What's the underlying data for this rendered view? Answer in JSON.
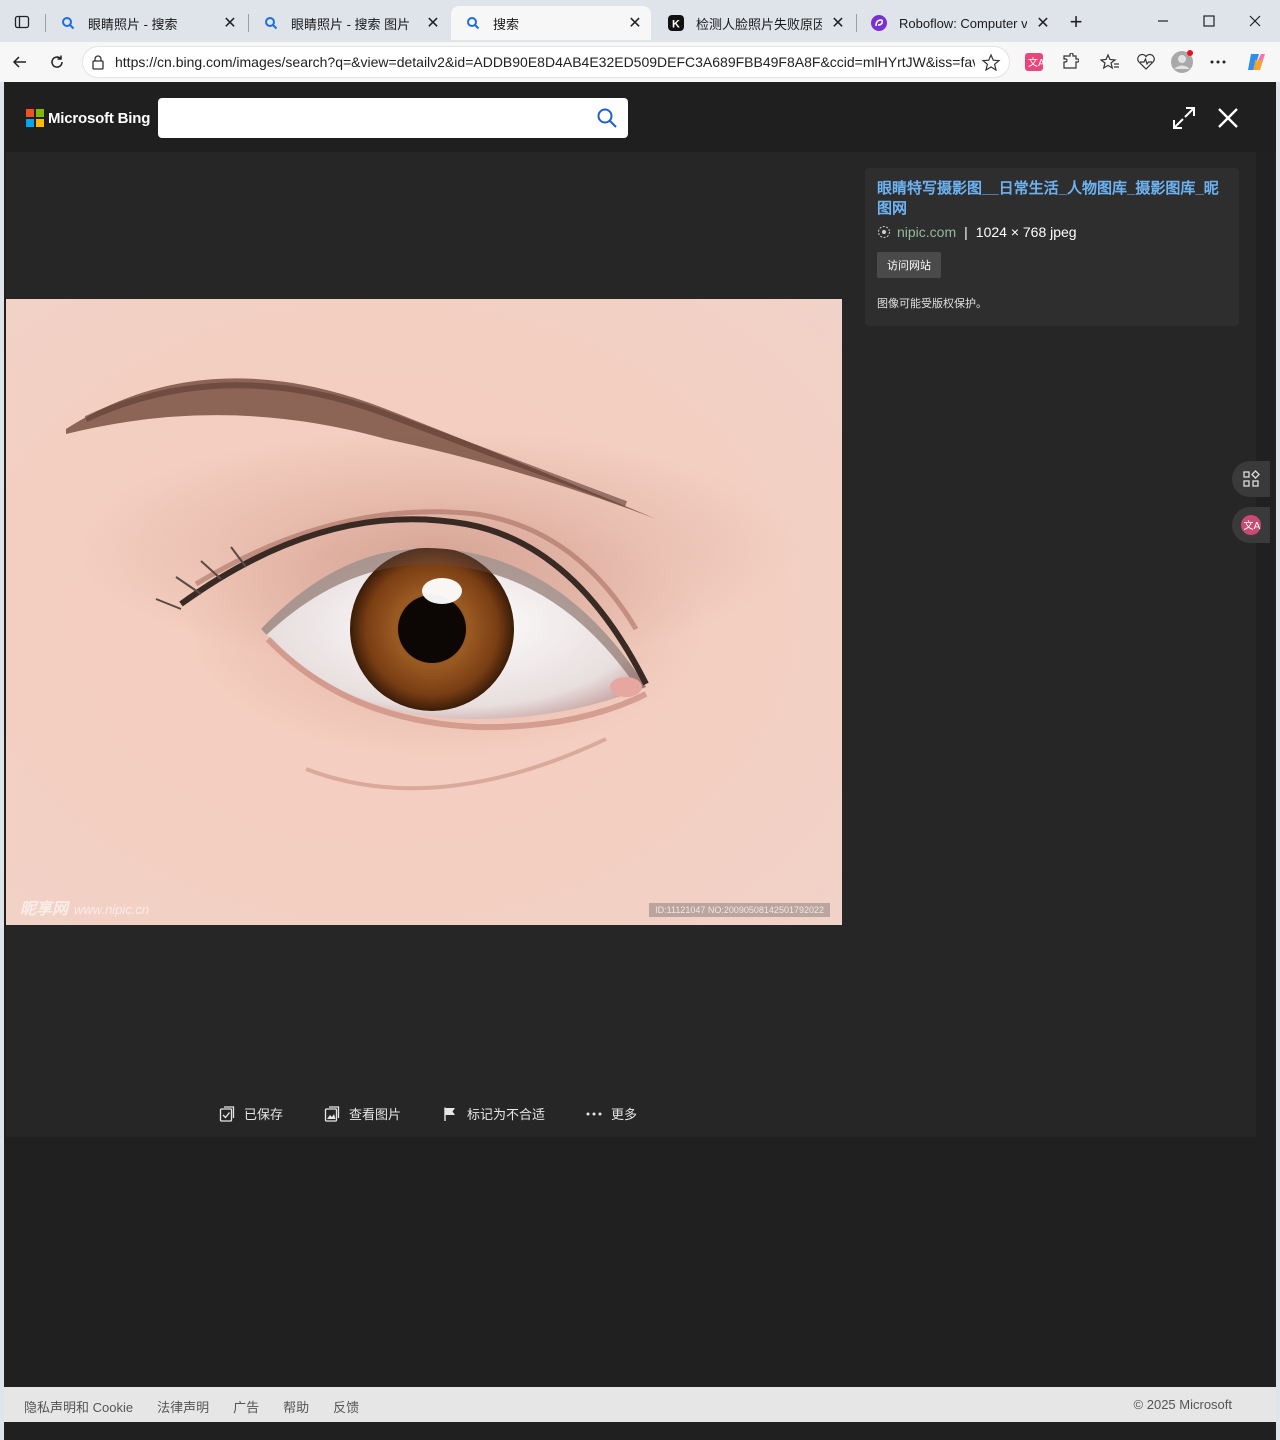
{
  "tabs": [
    {
      "title": "眼睛照片 - 搜索",
      "favicon": "bing-search-icon",
      "active": false
    },
    {
      "title": "眼睛照片 - 搜索 图片",
      "favicon": "bing-search-icon",
      "active": false
    },
    {
      "title": "搜索",
      "favicon": "bing-search-icon",
      "active": true
    },
    {
      "title": "检测人脸照片失败原因排查",
      "favicon": "k-logo-icon",
      "active": false
    },
    {
      "title": "Roboflow: Computer vision",
      "favicon": "roboflow-icon",
      "active": false
    }
  ],
  "address_bar": {
    "url": "https://cn.bing.com/images/search?q=&view=detailv2&id=ADDB90E8D4AB4E32ED509DEFC3A689FBB49F8A8F&ccid=mlHYrtJW&iss=fav..."
  },
  "bing": {
    "brand": "Microsoft Bing",
    "search_value": "",
    "search_placeholder": ""
  },
  "image_info": {
    "title": "眼睛特写摄影图__日常生活_人物图库_摄影图库_昵图网",
    "domain": "nipic.com",
    "separator": "|",
    "dimensions": "1024 × 768 jpeg",
    "visit_label": "访问网站",
    "copyright_note": "图像可能受版权保护。"
  },
  "photo": {
    "watermark_left": "昵享网",
    "watermark_left_url": "www.nipic.cn",
    "watermark_right": "ID:11121047 NO:20090508142501792022"
  },
  "actions": [
    {
      "label": "已保存",
      "icon": "saved-icon"
    },
    {
      "label": "查看图片",
      "icon": "view-image-icon"
    },
    {
      "label": "标记为不合适",
      "icon": "flag-icon"
    },
    {
      "label": "更多",
      "icon": "more-icon"
    }
  ],
  "footer": {
    "links": [
      "隐私声明和 Cookie",
      "法律声明",
      "广告",
      "帮助",
      "反馈"
    ],
    "copyright": "© 2025 Microsoft"
  },
  "colors": {
    "link_blue": "#6db3f2",
    "domain_green": "#94b99c",
    "overlay_bg": "#262626"
  }
}
